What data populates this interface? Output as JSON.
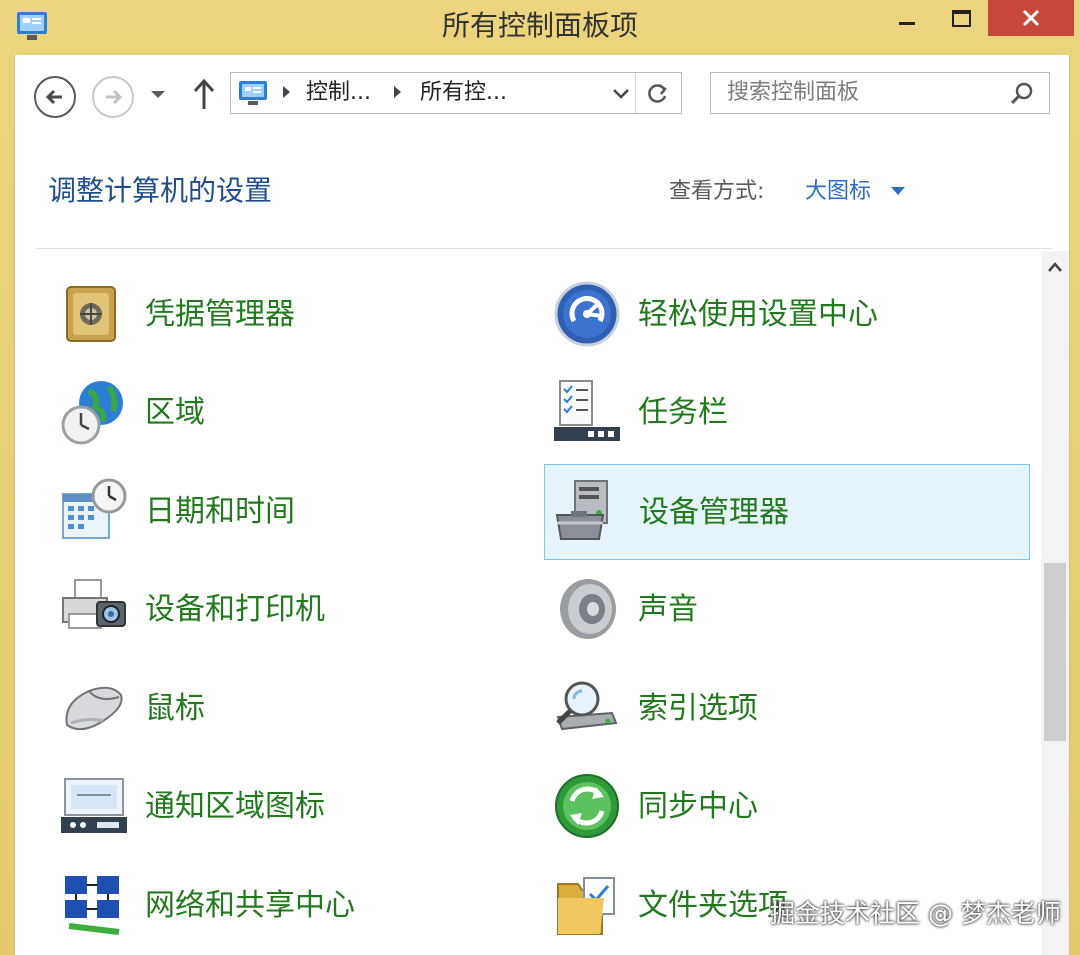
{
  "window": {
    "title": "所有控制面板项",
    "icon": "control-panel-icon",
    "controls": [
      "minimize-icon",
      "maximize-icon",
      "close-icon"
    ]
  },
  "nav": {
    "back_icon": "back-arrow-icon",
    "forward_icon": "forward-arrow-icon",
    "recent_icon": "chevron-down-icon",
    "up_icon": "up-arrow-icon",
    "breadcrumbs": [
      "控制...",
      "所有控..."
    ],
    "refresh_icon": "refresh-icon",
    "search_placeholder": "搜索控制面板"
  },
  "header": {
    "title": "调整计算机的设置",
    "view_label": "查看方式:",
    "view_value": "大图标"
  },
  "items": [
    {
      "label": "凭据管理器",
      "icon": "credential-vault-icon"
    },
    {
      "label": "轻松使用设置中心",
      "icon": "ease-of-access-icon"
    },
    {
      "label": "区域",
      "icon": "region-globe-clock-icon"
    },
    {
      "label": "任务栏",
      "icon": "taskbar-checklist-icon"
    },
    {
      "label": "日期和时间",
      "icon": "calendar-clock-icon"
    },
    {
      "label": "设备管理器",
      "icon": "device-manager-icon"
    },
    {
      "label": "设备和打印机",
      "icon": "printer-camera-icon"
    },
    {
      "label": "声音",
      "icon": "speaker-icon"
    },
    {
      "label": "鼠标",
      "icon": "mouse-icon"
    },
    {
      "label": "索引选项",
      "icon": "magnifier-drive-icon"
    },
    {
      "label": "通知区域图标",
      "icon": "notification-area-icon"
    },
    {
      "label": "同步中心",
      "icon": "sync-center-icon"
    },
    {
      "label": "网络和共享中心",
      "icon": "network-sharing-icon"
    },
    {
      "label": "文件夹选项",
      "icon": "folder-options-icon"
    }
  ],
  "selected_item": "设备管理器",
  "colors": {
    "link_green": "#237a1e",
    "title_blue": "#1f4e8c",
    "view_blue": "#2a6dc4",
    "selection_bg": "#e5f3fb",
    "frame": "#e8cf72",
    "close_red": "#c7473a"
  },
  "watermark": "掘金技术社区 @ 梦杰老师"
}
